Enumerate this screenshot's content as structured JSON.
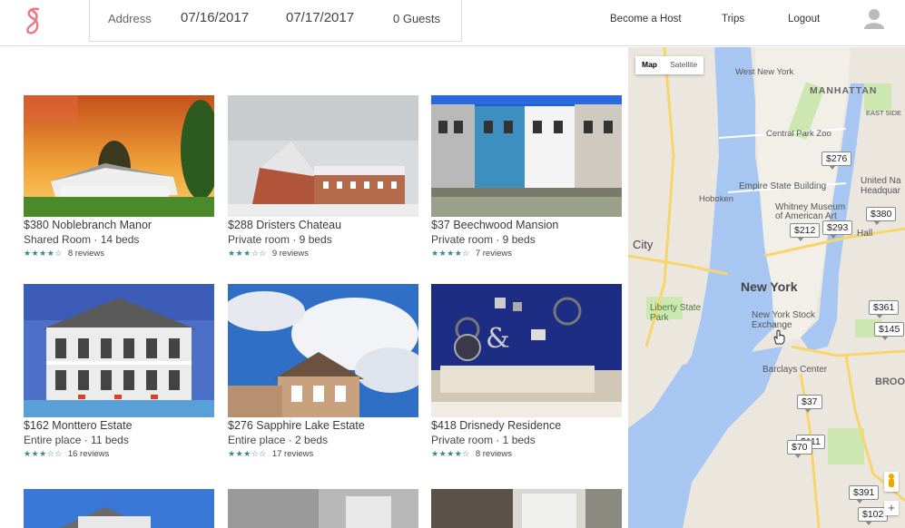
{
  "header": {
    "search": {
      "address_placeholder": "Address",
      "checkin": "07/16/2017",
      "checkout": "07/17/2017",
      "guests": "0 Guests"
    },
    "nav": {
      "host": "Become a Host",
      "trips": "Trips",
      "logout": "Logout"
    }
  },
  "listings": [
    {
      "title": "$380 Noblebranch Manor",
      "sub": "Shared Room · 14 beds",
      "stars": "★★★★☆",
      "reviews": "8 reviews"
    },
    {
      "title": "$288 Dristers Chateau",
      "sub": "Private room · 9 beds",
      "stars": "★★★☆☆",
      "reviews": "9 reviews"
    },
    {
      "title": "$37 Beechwood Mansion",
      "sub": "Private room · 9 beds",
      "stars": "★★★★☆",
      "reviews": "7 reviews"
    },
    {
      "title": "$162 Monttero Estate",
      "sub": "Entire place · 11 beds",
      "stars": "★★★☆☆",
      "reviews": "16 reviews"
    },
    {
      "title": "$276 Sapphire Lake Estate",
      "sub": "Entire place · 2 beds",
      "stars": "★★★☆☆",
      "reviews": "17 reviews"
    },
    {
      "title": "$418 Drisnedy Residence",
      "sub": "Private room · 1 beds",
      "stars": "★★★★☆",
      "reviews": "8 reviews"
    }
  ],
  "map": {
    "toggle": {
      "map": "Map",
      "satellite": "Satellite"
    },
    "labels": {
      "west_new_york": "West New York",
      "manhattan": "MANHATTAN",
      "east_side": "EAST SIDE",
      "central_park_zoo": "Central Park Zoo",
      "hoboken": "Hoboken",
      "empire": "Empire State Building",
      "whitney": "Whitney Museum of American Art",
      "city": "City",
      "new_york": "New York",
      "nyse": "New York Stock Exchange",
      "liberty": "Liberty State Park",
      "barclays": "Barclays Center",
      "united_nations": "United Na Headquar",
      "broo": "BROO",
      "hall": "Hall"
    },
    "pins": [
      "$276",
      "$380",
      "$212",
      "$293",
      "$361",
      "$145",
      "$37",
      "$111",
      "$70",
      "$391",
      "$102"
    ],
    "zoom_in": "+"
  }
}
